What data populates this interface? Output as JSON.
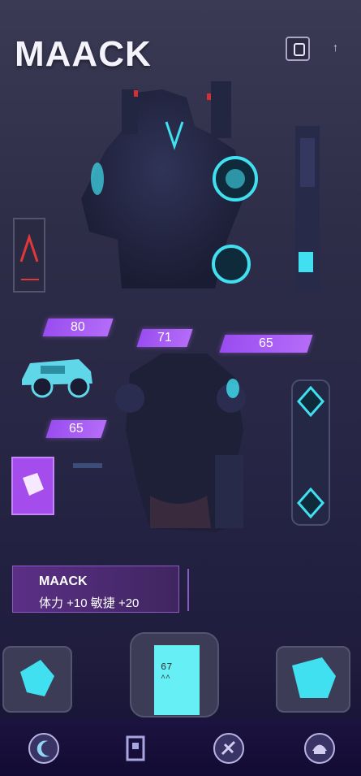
{
  "title": "MAACK",
  "stat_badges": {
    "b1": "80",
    "b2": "71",
    "b3": "65",
    "b4": "65"
  },
  "info": {
    "name": "MAACK",
    "stats": "体力 +10  敏捷 +20"
  },
  "card_text": {
    "line1": "67",
    "line2": "^^"
  },
  "nav": {
    "items": [
      "moon-nav-icon",
      "character-nav-icon",
      "weapon-nav-icon",
      "helmet-nav-icon"
    ]
  },
  "colors": {
    "accent_purple": "#b46cf8",
    "accent_cyan": "#40e0f0",
    "background": "#2e2d48"
  }
}
